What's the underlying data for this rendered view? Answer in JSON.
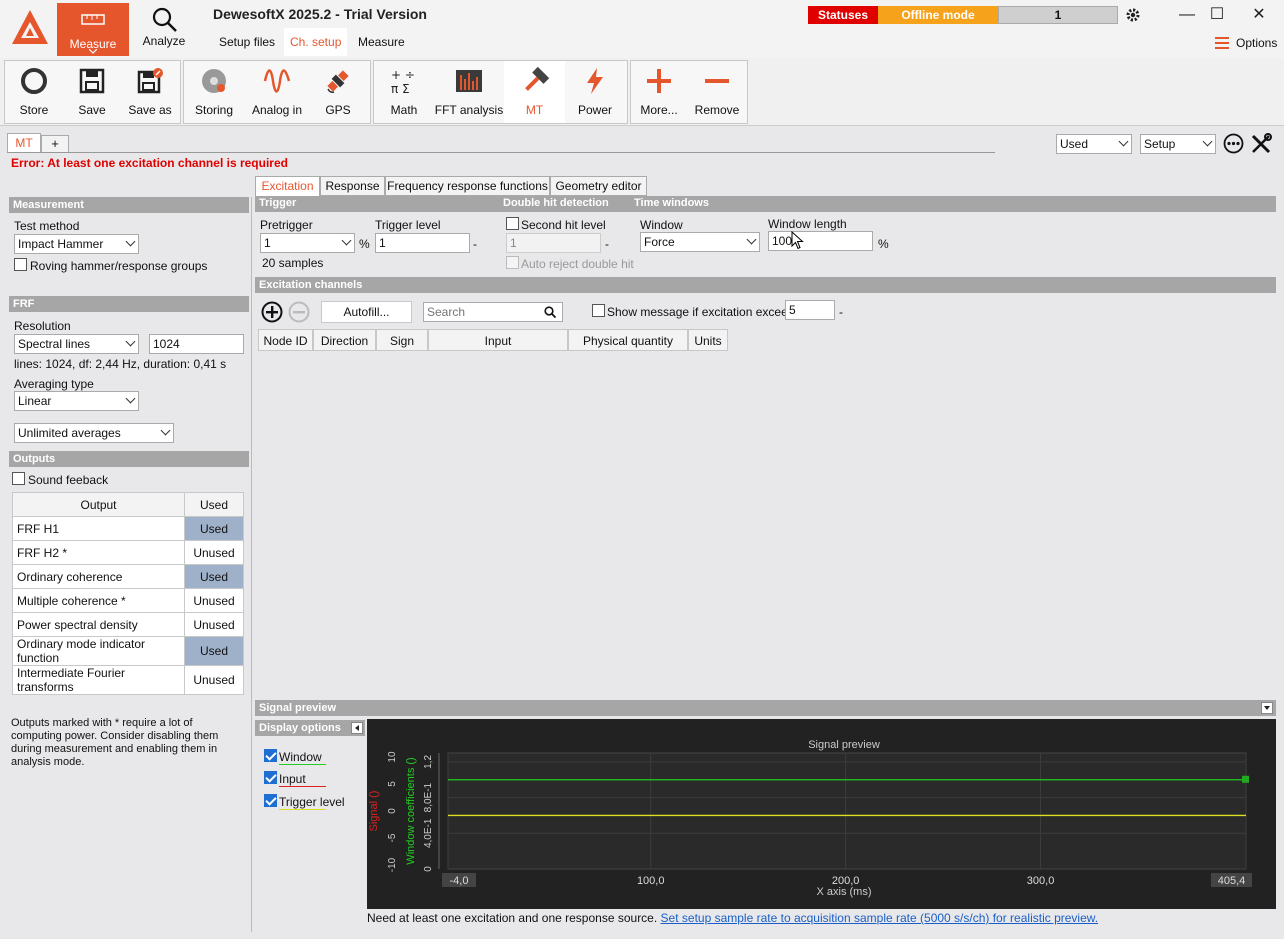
{
  "app": {
    "title": "DewesoftX 2025.2 - Trial Version",
    "modes": {
      "measure": "Measure",
      "analyze": "Analyze"
    },
    "subtabs": [
      "Setup files",
      "Ch. setup",
      "Measure"
    ],
    "status": {
      "statuses": "Statuses",
      "mode": "Offline mode",
      "count": "1"
    },
    "options_label": "Options"
  },
  "ribbon": {
    "store": "Store",
    "save": "Save",
    "save_as": "Save as",
    "storing": "Storing",
    "analog_in": "Analog in",
    "gps": "GPS",
    "math": "Math",
    "fft": "FFT analysis",
    "mt": "MT",
    "power": "Power",
    "more": "More...",
    "remove": "Remove"
  },
  "module_tabs": {
    "active": "MT",
    "add": "+"
  },
  "top_right": {
    "filter": "Used",
    "view": "Setup"
  },
  "error": "Error: At least one excitation channel is required",
  "measurement": {
    "header": "Measurement",
    "test_method_label": "Test method",
    "test_method": "Impact Hammer",
    "roving": "Roving hammer/response groups"
  },
  "frf": {
    "header": "FRF",
    "resolution_label": "Resolution",
    "resolution_type": "Spectral lines",
    "resolution_value": "1024",
    "info": "lines: 1024, df: 2,44 Hz, duration: 0,41 s",
    "averaging_label": "Averaging type",
    "averaging": "Linear",
    "averages": "Unlimited averages"
  },
  "outputs": {
    "header": "Outputs",
    "sound_feedback": "Sound feeback",
    "col_output": "Output",
    "col_used": "Used",
    "rows": [
      {
        "name": "FRF H1",
        "state": "Used"
      },
      {
        "name": "FRF H2 *",
        "state": "Unused"
      },
      {
        "name": "Ordinary coherence",
        "state": "Used"
      },
      {
        "name": "Multiple coherence *",
        "state": "Unused"
      },
      {
        "name": "Power spectral density",
        "state": "Unused"
      },
      {
        "name": "Ordinary mode indicator function",
        "state": "Used"
      },
      {
        "name": "Intermediate Fourier transforms",
        "state": "Unused"
      }
    ],
    "note": "Outputs marked with * require a lot of computing power. Consider disabling them during measurement and enabling them in analysis mode."
  },
  "content_tabs": [
    "Excitation",
    "Response",
    "Frequency response functions",
    "Geometry editor"
  ],
  "trigger": {
    "header": "Trigger",
    "pretrigger_label": "Pretrigger",
    "pretrigger": "1",
    "pct": "%",
    "samples": "20 samples",
    "level_label": "Trigger level",
    "level": "1",
    "dash": "-"
  },
  "double_hit": {
    "header": "Double hit detection",
    "second_hit": "Second hit level",
    "value": "1",
    "dash": "-",
    "auto_reject": "Auto reject double hit"
  },
  "time_windows": {
    "header": "Time windows",
    "window_label": "Window",
    "window": "Force",
    "length_label": "Window length",
    "length": "100",
    "pct": "%"
  },
  "excitation": {
    "header": "Excitation channels",
    "autofill": "Autofill...",
    "search_placeholder": "Search",
    "show_msg": "Show message if excitation exceeds",
    "exceeds_value": "5",
    "dash": "-",
    "columns": [
      "Node ID",
      "Direction",
      "Sign",
      "Input",
      "Physical quantity",
      "Units"
    ]
  },
  "preview": {
    "header": "Signal preview",
    "display_options": "Display options",
    "legend": [
      {
        "label": "Window",
        "color": "#22cc22"
      },
      {
        "label": "Input",
        "color": "#dd2222"
      },
      {
        "label": "Trigger level",
        "color": "#dddd22"
      }
    ],
    "footer_text": "Need at least one excitation and one response source.",
    "footer_link": "Set setup sample rate to acquisition sample rate (5000 s/s/ch) for realistic preview."
  },
  "chart_data": {
    "type": "line",
    "title": "Signal preview",
    "xlabel": "X axis (ms)",
    "xlim": [
      -4.0,
      405.4
    ],
    "x_ticks": [
      "-4,0",
      "100,0",
      "200,0",
      "300,0",
      "405,4"
    ],
    "y_left_label": "Signal ()",
    "y_left_ticks": [
      "-10",
      "-5",
      "0",
      "5",
      "10"
    ],
    "y_right_label": "Window coefficients ()",
    "y_right_ticks": [
      "0",
      "4,0E-1",
      "8,0E-1",
      "1,2"
    ],
    "grid": true,
    "series": [
      {
        "name": "Window",
        "color": "#22cc22",
        "x": [
          -4.0,
          405.4
        ],
        "y": [
          1.0,
          1.0
        ]
      },
      {
        "name": "Trigger level",
        "color": "#dddd22",
        "x": [
          -4.0,
          405.4
        ],
        "y": [
          1.0,
          1.0
        ]
      }
    ]
  }
}
